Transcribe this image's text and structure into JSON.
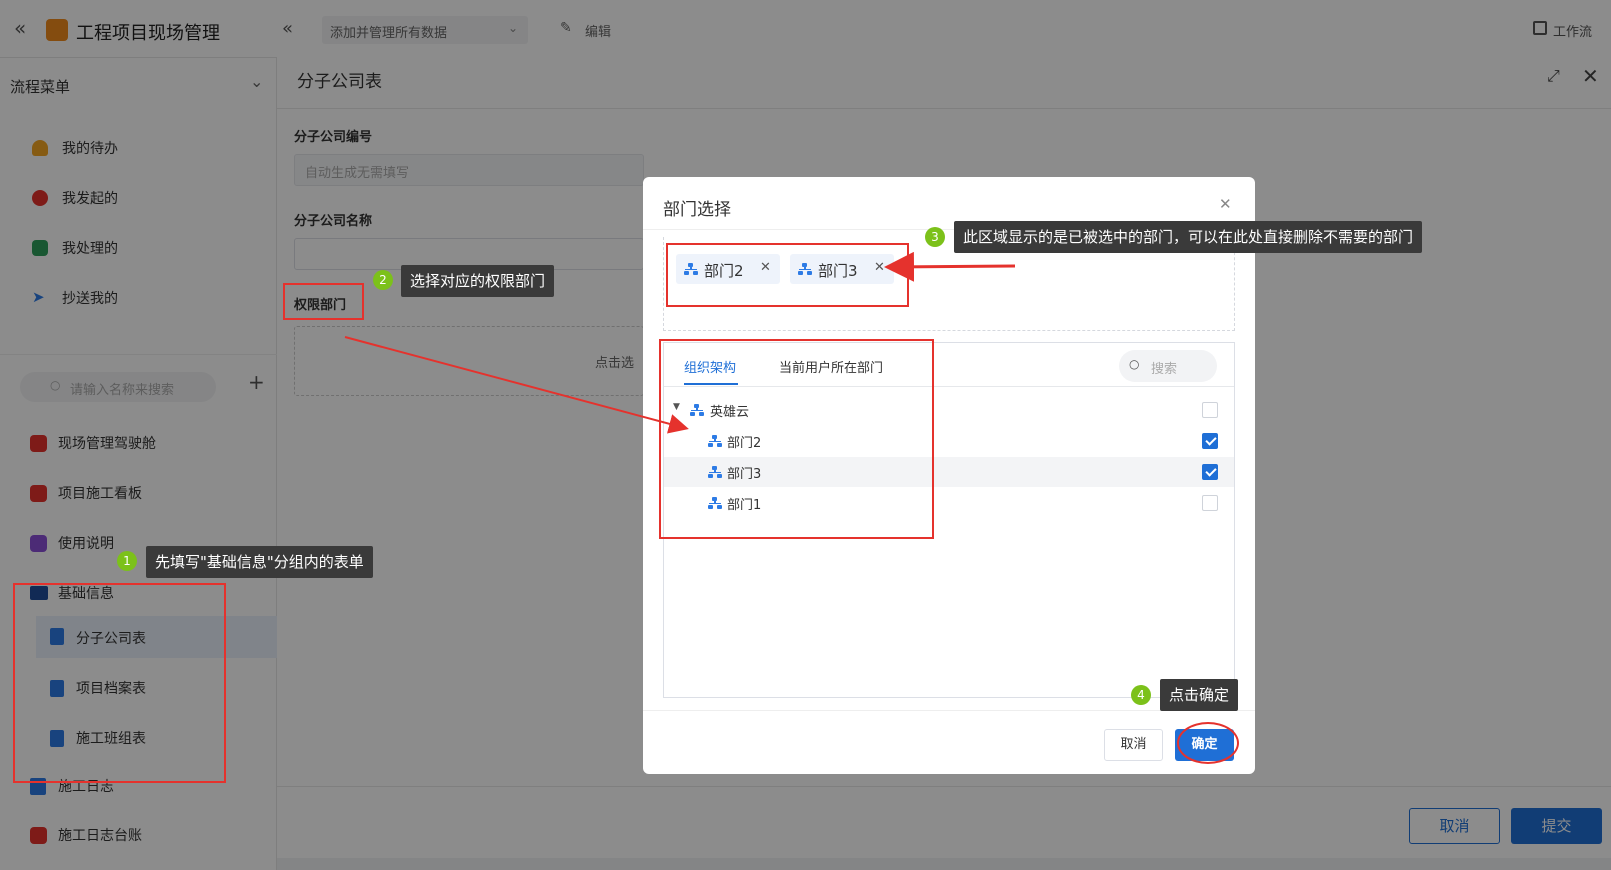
{
  "topbar": {
    "app_title": "工程项目现场管理",
    "view_select": "添加并管理所有数据",
    "edit_label": "编辑",
    "workflow_label": "工作流"
  },
  "sidebar": {
    "menu_title": "流程菜单",
    "flow_items": [
      {
        "label": "我的待办",
        "icon": "bell-icon",
        "color": "#f5a623"
      },
      {
        "label": "我发起的",
        "icon": "play-icon",
        "color": "#e5322d"
      },
      {
        "label": "我处理的",
        "icon": "inbox-icon",
        "color": "#2e9e5b"
      },
      {
        "label": "抄送我的",
        "icon": "send-icon",
        "color": "#2d7be5"
      }
    ],
    "search_placeholder": "请输入名称来搜索",
    "apps": [
      {
        "label": "现场管理驾驶舱",
        "color": "#e5322d"
      },
      {
        "label": "项目施工看板",
        "color": "#e5322d"
      },
      {
        "label": "使用说明",
        "color": "#8a4fd8"
      }
    ],
    "group": {
      "label": "基础信息",
      "items": [
        "分子公司表",
        "项目档案表",
        "施工班组表"
      ]
    },
    "after_group": [
      {
        "label": "施工日志",
        "color": "#2d7be5"
      },
      {
        "label": "施工日志台账",
        "color": "#e5322d"
      }
    ]
  },
  "form": {
    "title": "分子公司表",
    "field1_label": "分子公司编号",
    "field1_placeholder": "自动生成无需填写",
    "field2_label": "分子公司名称",
    "field3_label": "权限部门",
    "field3_hint": "点击选",
    "cancel_label": "取消",
    "submit_label": "提交"
  },
  "dialog": {
    "title": "部门选择",
    "selected": [
      "部门2",
      "部门3"
    ],
    "tabs": [
      "组织架构",
      "当前用户所在部门"
    ],
    "active_tab": "组织架构",
    "search_placeholder": "搜索",
    "tree": {
      "root": {
        "label": "英雄云",
        "checked": false
      },
      "children": [
        {
          "label": "部门2",
          "checked": true
        },
        {
          "label": "部门3",
          "checked": true
        },
        {
          "label": "部门1",
          "checked": false
        }
      ]
    },
    "cancel_label": "取消",
    "ok_label": "确定"
  },
  "annotations": [
    {
      "n": "1",
      "text": "先填写\"基础信息\"分组内的表单"
    },
    {
      "n": "2",
      "text": "选择对应的权限部门"
    },
    {
      "n": "3",
      "text": "此区域显示的是已被选中的部门，可以在此处直接删除不需要的部门"
    },
    {
      "n": "4",
      "text": "点击确定"
    }
  ],
  "colors": {
    "accent": "#1f6fd6",
    "annotation_red": "#e5322d",
    "badge_green": "#7cc11a"
  }
}
